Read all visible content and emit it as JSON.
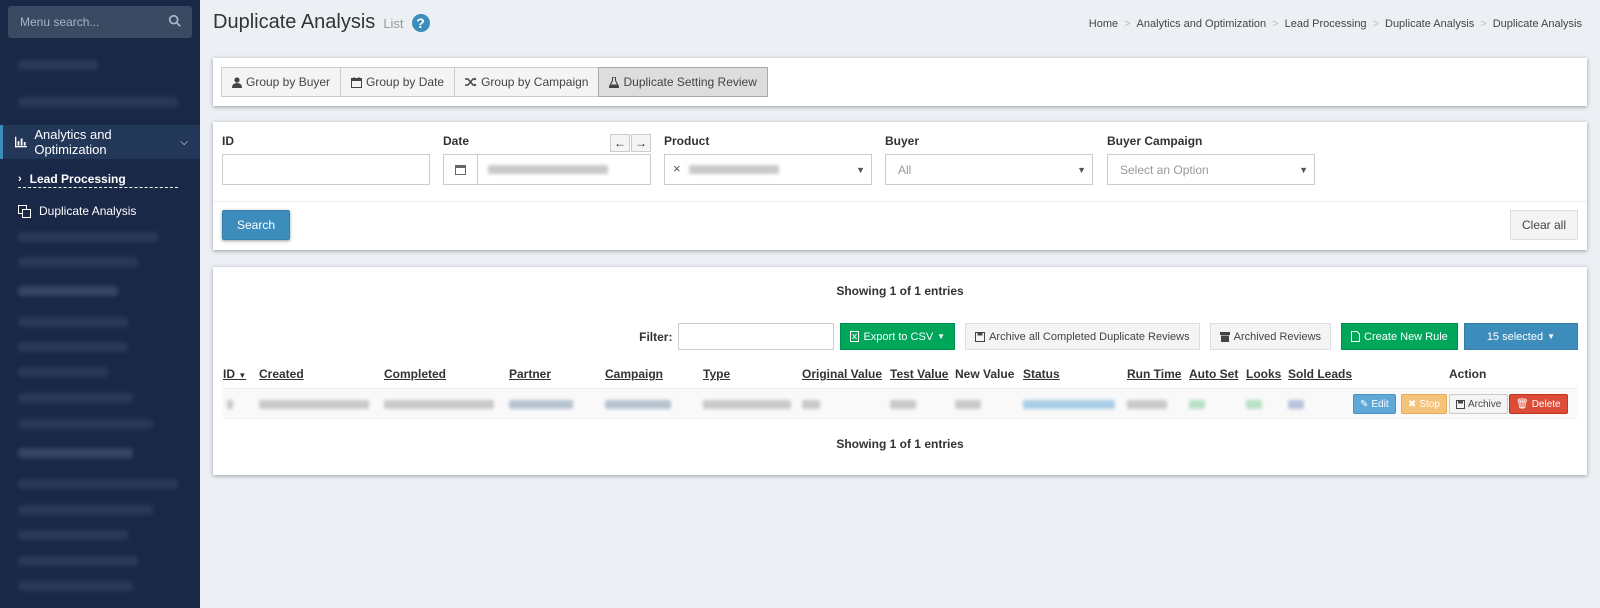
{
  "sidebar": {
    "search_placeholder": "Menu search...",
    "active_item": "Analytics and Optimization",
    "lead_processing": "Lead Processing",
    "duplicate_analysis": "Duplicate Analysis"
  },
  "header": {
    "title": "Duplicate Analysis",
    "subtitle": "List",
    "help": "?"
  },
  "breadcrumb": [
    "Home",
    "Analytics and Optimization",
    "Lead Processing",
    "Duplicate Analysis",
    "Duplicate Analysis"
  ],
  "tabs": [
    {
      "label": "Group by Buyer",
      "icon": "user-icon"
    },
    {
      "label": "Group by Date",
      "icon": "calendar-icon"
    },
    {
      "label": "Group by Campaign",
      "icon": "shuffle-icon"
    },
    {
      "label": "Duplicate Setting Review",
      "icon": "flask-icon",
      "active": true
    }
  ],
  "filters": {
    "id_label": "ID",
    "date_label": "Date",
    "product_label": "Product",
    "buyer_label": "Buyer",
    "buyer_value": "All",
    "buyer_campaign_label": "Buyer Campaign",
    "buyer_campaign_placeholder": "Select an Option",
    "search_button": "Search",
    "clear_button": "Clear all"
  },
  "table": {
    "showing_top": "Showing 1 of 1 entries",
    "showing_bottom": "Showing 1 of 1 entries",
    "filter_label": "Filter:",
    "export_button": "Export to CSV",
    "archive_all_button": "Archive all Completed Duplicate Reviews",
    "archived_button": "Archived Reviews",
    "create_button": "Create New Rule",
    "selected_button": "15 selected",
    "columns": [
      "ID",
      "Created",
      "Completed",
      "Partner",
      "Campaign",
      "Type",
      "Original Value",
      "Test Value",
      "New Value",
      "Status",
      "Run Time",
      "Auto Set",
      "Looks",
      "Sold Leads",
      "Action"
    ],
    "row_actions": [
      "Edit",
      "Stop",
      "Archive",
      "Delete"
    ]
  },
  "colors": {
    "sidebar_bg": "#1a2847",
    "primary": "#3c8dbc",
    "success": "#00a65a",
    "danger": "#dd4b39",
    "warning": "#f5c27a"
  }
}
